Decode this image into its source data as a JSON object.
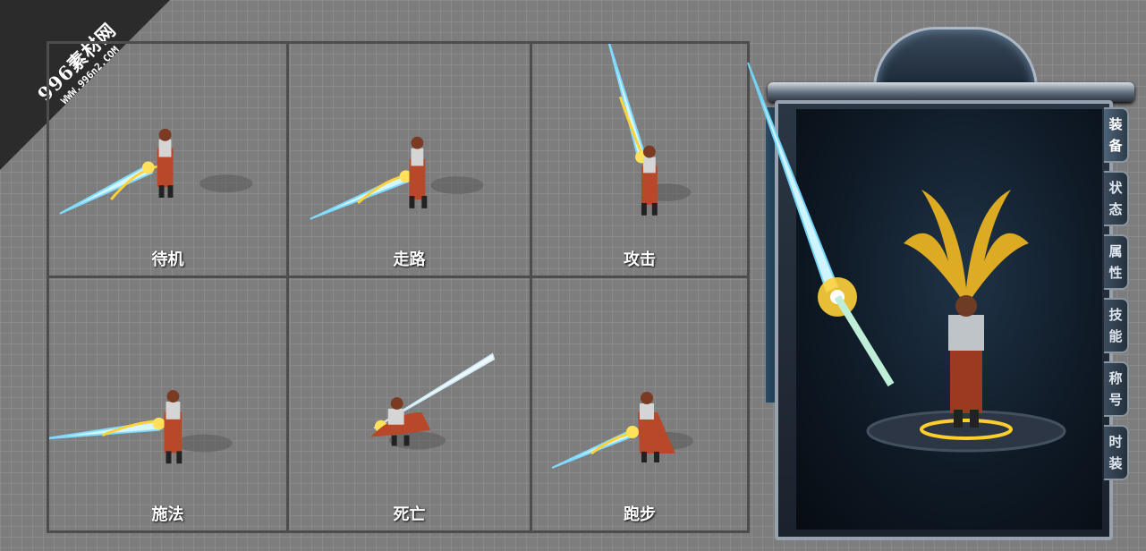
{
  "watermark": {
    "main": "996素材网",
    "sub": "WWW.996n2.COM"
  },
  "animations": [
    {
      "label": "待机",
      "pose": "idle"
    },
    {
      "label": "走路",
      "pose": "walk"
    },
    {
      "label": "攻击",
      "pose": "attack"
    },
    {
      "label": "施法",
      "pose": "cast"
    },
    {
      "label": "死亡",
      "pose": "death"
    },
    {
      "label": "跑步",
      "pose": "run"
    }
  ],
  "panel": {
    "tabs": [
      {
        "c1": "装",
        "c2": "备"
      },
      {
        "c1": "状",
        "c2": "态"
      },
      {
        "c1": "属",
        "c2": "性"
      },
      {
        "c1": "技",
        "c2": "能"
      },
      {
        "c1": "称",
        "c2": "号"
      },
      {
        "c1": "时",
        "c2": "装"
      }
    ]
  },
  "colors": {
    "blade": "#bfefff",
    "glow": "#ffd23a",
    "armor": "#b8482a"
  }
}
